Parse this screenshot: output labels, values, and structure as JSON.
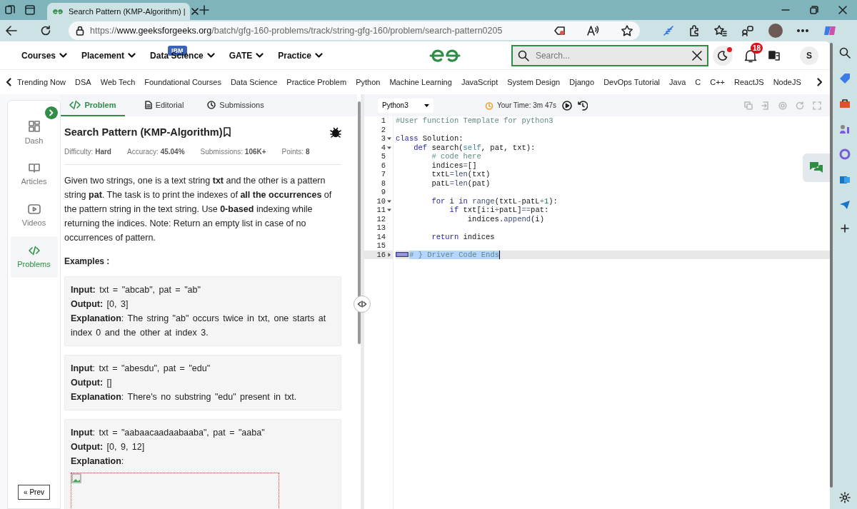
{
  "browser": {
    "tab_title": "Search Pattern (KMP-Algorithm) |",
    "url": "https://**www.geeksforgeeks.org**/batch/gfg-160-problems/track/string-gfg-160/problem/search-pattern0205"
  },
  "nav": {
    "menus": [
      {
        "label": "Courses"
      },
      {
        "label": "Placement"
      },
      {
        "label": "Data Science",
        "badge": "IBM"
      },
      {
        "label": "GATE"
      },
      {
        "label": "Practice"
      }
    ],
    "search": {
      "placeholder": "Search..."
    },
    "notifications": "18",
    "avatar": "S"
  },
  "subnav": [
    "Trending Now",
    "DSA",
    "Web Tech",
    "Foundational Courses",
    "Data Science",
    "Practice Problem",
    "Python",
    "Machine Learning",
    "JavaScript",
    "System Design",
    "Django",
    "DevOps Tutorial",
    "Java",
    "C",
    "C++",
    "ReactJS",
    "NodeJS"
  ],
  "rail": [
    {
      "label": "Dash",
      "kind": "dash",
      "selected": false
    },
    {
      "label": "Articles",
      "kind": "book",
      "selected": false
    },
    {
      "label": "Videos",
      "kind": "video",
      "selected": false
    },
    {
      "label": "Problems",
      "kind": "code",
      "selected": true
    }
  ],
  "prev": "« Prev",
  "tabs": [
    {
      "label": "Problem",
      "kind": "code",
      "selected": true
    },
    {
      "label": "Editorial",
      "kind": "doc",
      "selected": false
    },
    {
      "label": "Submissions",
      "kind": "clock",
      "selected": false
    }
  ],
  "problem": {
    "title": "Search Pattern (KMP-Algorithm)",
    "meta": [
      {
        "label": "Difficulty:",
        "value": "Hard"
      },
      {
        "label": "Accuracy:",
        "value": "45.04%"
      },
      {
        "label": "Submissions:",
        "value": "106K+"
      },
      {
        "label": "Points:",
        "value": "8"
      }
    ],
    "description": "Given two strings, one is a text string **txt** and the other is a pattern string **pat**. The task is to print the indexes of **all the occurrences** of the pattern string in the text string. Use **0-based** indexing while returning the indices. Note: Return an empty list in case of no occurrences of pattern.",
    "examples_heading": "Examples :",
    "examples": [
      {
        "lines": [
          "**Input:** txt = \"abcab\", pat = \"ab\"",
          "**Output:** [0, 3]",
          "**Explanation**: The string \"ab\" occurs twice in txt, one starts at index 0 and the other at index 3."
        ],
        "broken_image": false
      },
      {
        "lines": [
          "**Input**: txt = \"abesdu\", pat = \"edu\"",
          "**Output:** []",
          "**Explanation**: There's no substring \"edu\" present in txt."
        ],
        "broken_image": false
      },
      {
        "lines": [
          "**Input**: txt = \"aabaacaadaabaaba\", pat = \"aaba\"",
          "**Output:** [0, 9, 12]",
          "**Explanation**:"
        ],
        "broken_image": true
      }
    ]
  },
  "editor": {
    "language": "Python3",
    "timer": "Your Time: 3m 47s",
    "lines": [
      {
        "number": "1",
        "foldable": false,
        "selected": false,
        "tokens": [
          {
            "kind": "comment",
            "text": "#User function Template for python3"
          }
        ]
      },
      {
        "number": "2",
        "foldable": false,
        "selected": false
      },
      {
        "number": "3",
        "foldable": true,
        "collapsed": false,
        "selected": false,
        "tokens": [
          {
            "kind": "keyword",
            "text": "class"
          },
          {
            "kind": "plain",
            "text": " Solution:"
          }
        ]
      },
      {
        "number": "4",
        "foldable": true,
        "collapsed": false,
        "selected": false,
        "tokens": [
          {
            "kind": "keyword",
            "text": "    def"
          },
          {
            "kind": "plain",
            "text": " search("
          },
          {
            "kind": "builtin",
            "text": "self"
          },
          {
            "kind": "plain",
            "text": ", pat, txt):"
          }
        ]
      },
      {
        "number": "5",
        "foldable": false,
        "selected": false,
        "tokens": [
          {
            "kind": "comment",
            "text": "        # code here"
          }
        ]
      },
      {
        "number": "6",
        "foldable": false,
        "selected": false,
        "tokens": [
          {
            "kind": "plain",
            "text": "        indices"
          },
          {
            "kind": "operator",
            "text": "="
          },
          {
            "kind": "plain",
            "text": "[]"
          }
        ]
      },
      {
        "number": "7",
        "foldable": false,
        "selected": false,
        "tokens": [
          {
            "kind": "plain",
            "text": "        txtL"
          },
          {
            "kind": "operator",
            "text": "="
          },
          {
            "kind": "function",
            "text": "len"
          },
          {
            "kind": "plain",
            "text": "(txt)"
          }
        ]
      },
      {
        "number": "8",
        "foldable": false,
        "selected": false,
        "tokens": [
          {
            "kind": "plain",
            "text": "        patL"
          },
          {
            "kind": "operator",
            "text": "="
          },
          {
            "kind": "function",
            "text": "len"
          },
          {
            "kind": "plain",
            "text": "(pat)"
          }
        ]
      },
      {
        "number": "9",
        "foldable": false,
        "selected": false
      },
      {
        "number": "10",
        "foldable": true,
        "collapsed": false,
        "selected": false,
        "tokens": [
          {
            "kind": "keyword",
            "text": "        for"
          },
          {
            "kind": "plain",
            "text": " i "
          },
          {
            "kind": "keyword",
            "text": "in"
          },
          {
            "kind": "function",
            "text": " range"
          },
          {
            "kind": "plain",
            "text": "(txtL"
          },
          {
            "kind": "operator",
            "text": "-"
          },
          {
            "kind": "plain",
            "text": "patL"
          },
          {
            "kind": "operator",
            "text": "+"
          },
          {
            "kind": "number",
            "text": "1"
          },
          {
            "kind": "plain",
            "text": "):"
          }
        ]
      },
      {
        "number": "11",
        "foldable": true,
        "collapsed": false,
        "selected": false,
        "tokens": [
          {
            "kind": "keyword",
            "text": "            if"
          },
          {
            "kind": "plain",
            "text": " txt[i:i"
          },
          {
            "kind": "operator",
            "text": "+"
          },
          {
            "kind": "plain",
            "text": "patL]"
          },
          {
            "kind": "operator",
            "text": "=="
          },
          {
            "kind": "plain",
            "text": "pat:"
          }
        ]
      },
      {
        "number": "12",
        "foldable": false,
        "selected": false,
        "tokens": [
          {
            "kind": "plain",
            "text": "                indices."
          },
          {
            "kind": "function",
            "text": "append"
          },
          {
            "kind": "plain",
            "text": "(i)"
          }
        ]
      },
      {
        "number": "13",
        "foldable": false,
        "selected": false
      },
      {
        "number": "14",
        "foldable": false,
        "selected": false,
        "tokens": [
          {
            "kind": "keyword",
            "text": "        return"
          },
          {
            "kind": "plain",
            "text": " indices"
          }
        ]
      },
      {
        "number": "15",
        "foldable": false,
        "selected": false
      },
      {
        "number": "16",
        "foldable": true,
        "collapsed": true,
        "selected": true,
        "tokens": [
          {
            "kind": "comment",
            "text": "# } Driver Code Ends"
          }
        ]
      }
    ]
  }
}
